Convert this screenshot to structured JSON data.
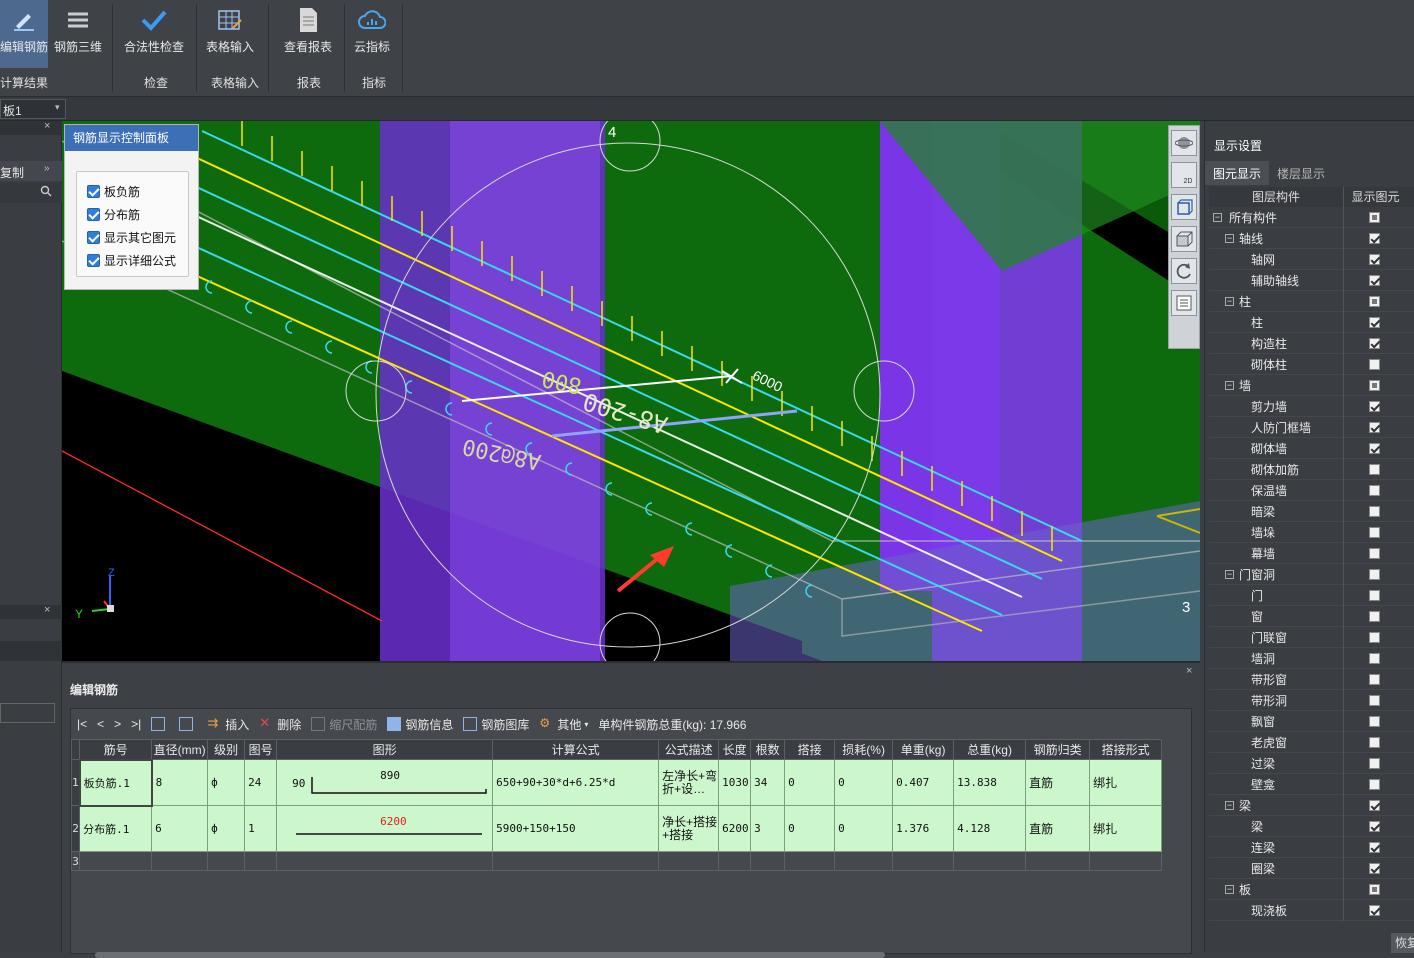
{
  "ribbon": {
    "buttons": [
      "编辑钢筋",
      "钢筋三维",
      "合法性检查",
      "表格输入",
      "查看报表",
      "云指标"
    ],
    "groups": [
      "计算结果",
      "检查",
      "表格输入",
      "报表",
      "指标"
    ]
  },
  "row2": {
    "combo_value": "板1"
  },
  "left": {
    "item_label": "复制"
  },
  "control_panel": {
    "title": "钢筋显示控制面板",
    "options": [
      "板负筋",
      "分布筋",
      "显示其它图元",
      "显示详细公式"
    ]
  },
  "viewport": {
    "labels": {
      "axis_4": "4",
      "axis_3": "3",
      "dim_6000": "6000",
      "txt_a": "A8-200",
      "txt_b": "A8@200",
      "txt_c": "800"
    },
    "axes": {
      "z": "Z",
      "y": "Y"
    }
  },
  "bottom": {
    "title": "编辑钢筋",
    "toolbar": {
      "nav": [
        "|<",
        "<",
        ">",
        ">|"
      ],
      "insert": "插入",
      "delete": "删除",
      "scale": "缩尺配筋",
      "info": "钢筋信息",
      "library": "钢筋图库",
      "other": "其他",
      "total_label": "单构件钢筋总重(kg): 17.966"
    },
    "columns": [
      "筋号",
      "直径(mm)",
      "级别",
      "图号",
      "图形",
      "计算公式",
      "公式描述",
      "长度",
      "根数",
      "搭接",
      "损耗(%)",
      "单重(kg)",
      "总重(kg)",
      "钢筋归类",
      "搭接形式"
    ],
    "rows": [
      {
        "no": "1",
        "name": "板负筋.1",
        "dia": "8",
        "grade": "ф",
        "fig": "24",
        "shape_left": "90",
        "shape_main": "890",
        "formula": "650+90+30*d+6.25*d",
        "desc": "左净长+弯折+设…",
        "len": "1030",
        "count": "34",
        "lap": "0",
        "loss": "0",
        "unit": "0.407",
        "total": "13.838",
        "cat": "直筋",
        "lapform": "绑扎"
      },
      {
        "no": "2",
        "name": "分布筋.1",
        "dia": "6",
        "grade": "ф",
        "fig": "1",
        "shape_main": "6200",
        "formula": "5900+150+150",
        "desc": "净长+搭接+搭接",
        "len": "6200",
        "count": "3",
        "lap": "0",
        "loss": "0",
        "unit": "1.376",
        "total": "4.128",
        "cat": "直筋",
        "lapform": "绑扎"
      },
      {
        "no": "3"
      }
    ]
  },
  "right": {
    "title": "显示设置",
    "tabs": [
      "图元显示",
      "楼层显示"
    ],
    "head": [
      "图层构件",
      "显示图元"
    ],
    "items": [
      {
        "n": "所有构件",
        "lvl": 0,
        "c": "part"
      },
      {
        "n": "轴线",
        "lvl": 1,
        "c": "on"
      },
      {
        "n": "轴网",
        "lvl": 2,
        "c": "on"
      },
      {
        "n": "辅助轴线",
        "lvl": 2,
        "c": "on"
      },
      {
        "n": "柱",
        "lvl": 1,
        "c": "part"
      },
      {
        "n": "柱",
        "lvl": 2,
        "c": "on"
      },
      {
        "n": "构造柱",
        "lvl": 2,
        "c": "on"
      },
      {
        "n": "砌体柱",
        "lvl": 2,
        "c": "off"
      },
      {
        "n": "墙",
        "lvl": 1,
        "c": "part"
      },
      {
        "n": "剪力墙",
        "lvl": 2,
        "c": "on"
      },
      {
        "n": "人防门框墙",
        "lvl": 2,
        "c": "on"
      },
      {
        "n": "砌体墙",
        "lvl": 2,
        "c": "on"
      },
      {
        "n": "砌体加筋",
        "lvl": 2,
        "c": "off"
      },
      {
        "n": "保温墙",
        "lvl": 2,
        "c": "off"
      },
      {
        "n": "暗梁",
        "lvl": 2,
        "c": "off"
      },
      {
        "n": "墙垛",
        "lvl": 2,
        "c": "off"
      },
      {
        "n": "幕墙",
        "lvl": 2,
        "c": "off"
      },
      {
        "n": "门窗洞",
        "lvl": 1,
        "c": "off"
      },
      {
        "n": "门",
        "lvl": 2,
        "c": "off"
      },
      {
        "n": "窗",
        "lvl": 2,
        "c": "off"
      },
      {
        "n": "门联窗",
        "lvl": 2,
        "c": "off"
      },
      {
        "n": "墙洞",
        "lvl": 2,
        "c": "off"
      },
      {
        "n": "带形窗",
        "lvl": 2,
        "c": "off"
      },
      {
        "n": "带形洞",
        "lvl": 2,
        "c": "off"
      },
      {
        "n": "飘窗",
        "lvl": 2,
        "c": "off"
      },
      {
        "n": "老虎窗",
        "lvl": 2,
        "c": "off"
      },
      {
        "n": "过梁",
        "lvl": 2,
        "c": "off"
      },
      {
        "n": "壁龛",
        "lvl": 2,
        "c": "off"
      },
      {
        "n": "梁",
        "lvl": 1,
        "c": "on"
      },
      {
        "n": "梁",
        "lvl": 2,
        "c": "on"
      },
      {
        "n": "连梁",
        "lvl": 2,
        "c": "on"
      },
      {
        "n": "圈梁",
        "lvl": 2,
        "c": "on"
      },
      {
        "n": "板",
        "lvl": 1,
        "c": "part"
      },
      {
        "n": "现浇板",
        "lvl": 2,
        "c": "on"
      }
    ],
    "restore": "恢复"
  }
}
